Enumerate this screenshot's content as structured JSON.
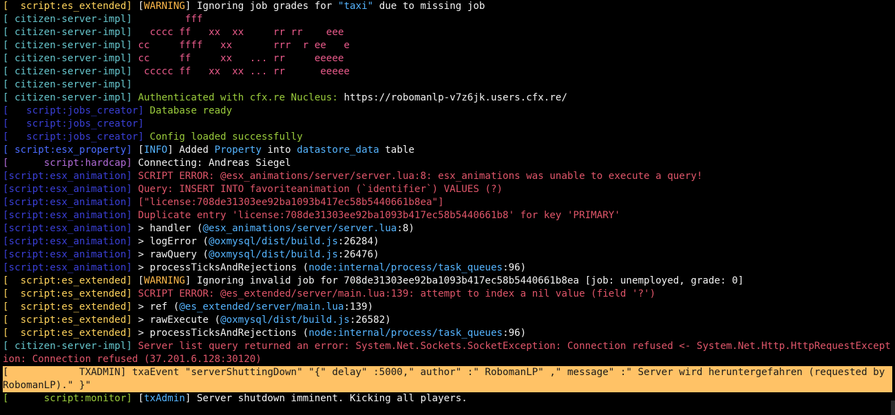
{
  "console": {
    "lines": [
      [
        [
          "c-yellow",
          "[  script:es_extended] "
        ],
        [
          "c-white",
          "["
        ],
        [
          "c-orange",
          "WARNING"
        ],
        [
          "c-white",
          "] Ignoring job grades for "
        ],
        [
          "c-lblue",
          "\"taxi\""
        ],
        [
          "c-white",
          " due to missing job"
        ]
      ],
      [
        [
          "c-cyan",
          "[ citizen-server-impl] "
        ],
        [
          "c-pink",
          "        fff"
        ]
      ],
      [
        [
          "c-cyan",
          "[ citizen-server-impl] "
        ],
        [
          "c-pink",
          "  cccc ff   xx  xx     rr rr    eee"
        ]
      ],
      [
        [
          "c-cyan",
          "[ citizen-server-impl] "
        ],
        [
          "c-pink",
          "cc     ffff   xx       rrr  r ee   e"
        ]
      ],
      [
        [
          "c-cyan",
          "[ citizen-server-impl] "
        ],
        [
          "c-pink",
          "cc     ff     xx   ... rr     eeeee"
        ]
      ],
      [
        [
          "c-cyan",
          "[ citizen-server-impl] "
        ],
        [
          "c-pink",
          " ccccc ff   xx  xx ... rr      eeeee"
        ]
      ],
      [
        [
          "c-cyan",
          "[ citizen-server-impl] "
        ]
      ],
      [
        [
          "c-cyan",
          "[ citizen-server-impl] "
        ],
        [
          "c-green",
          "Authenticated with cfx.re Nucleus: "
        ],
        [
          "c-white",
          "https://robomanlp-v7z6jk.users.cfx.re/"
        ]
      ],
      [
        [
          "c-navy",
          "[   script:jobs_creator] "
        ],
        [
          "c-green",
          "Database ready"
        ]
      ],
      [
        [
          "c-navy",
          "[   script:jobs_creator] "
        ]
      ],
      [
        [
          "c-navy",
          "[   script:jobs_creator] "
        ],
        [
          "c-green",
          "Config loaded successfully"
        ]
      ],
      [
        [
          "c-blue",
          "[ script:esx_property] "
        ],
        [
          "c-white",
          "["
        ],
        [
          "c-lblue",
          "INFO"
        ],
        [
          "c-white",
          "] Added "
        ],
        [
          "c-lblue",
          "Property"
        ],
        [
          "c-white",
          " into "
        ],
        [
          "c-lblue",
          "datastore_data"
        ],
        [
          "c-white",
          " table"
        ]
      ],
      [
        [
          "c-purple",
          "[      script:hardcap] "
        ],
        [
          "c-white",
          "Connecting: Andreas Siegel"
        ]
      ],
      [
        [
          "c-navy",
          "[script:esx_animation] "
        ],
        [
          "c-red",
          "SCRIPT ERROR: @esx_animations/server/server.lua:8: esx_animations was unable to execute a query!"
        ]
      ],
      [
        [
          "c-navy",
          "[script:esx_animation] "
        ],
        [
          "c-red",
          "Query: INSERT INTO favoriteanimation (`identifier`) VALUES (?)"
        ]
      ],
      [
        [
          "c-navy",
          "[script:esx_animation] "
        ],
        [
          "c-red",
          "[\"license:708de31303ee92ba1093b417ec58b5440661b8ea\"]"
        ]
      ],
      [
        [
          "c-navy",
          "[script:esx_animation] "
        ],
        [
          "c-red",
          "Duplicate entry 'license:708de31303ee92ba1093b417ec58b5440661b8' for key 'PRIMARY'"
        ]
      ],
      [
        [
          "c-navy",
          "[script:esx_animation] "
        ],
        [
          "c-white",
          "> handler ("
        ],
        [
          "c-lblue",
          "@esx_animations/server/server.lua"
        ],
        [
          "c-white",
          ":8)"
        ]
      ],
      [
        [
          "c-navy",
          "[script:esx_animation] "
        ],
        [
          "c-white",
          "> logError ("
        ],
        [
          "c-lblue",
          "@oxmysql/dist/build.js"
        ],
        [
          "c-white",
          ":26284)"
        ]
      ],
      [
        [
          "c-navy",
          "[script:esx_animation] "
        ],
        [
          "c-white",
          "> rawQuery ("
        ],
        [
          "c-lblue",
          "@oxmysql/dist/build.js"
        ],
        [
          "c-white",
          ":26476)"
        ]
      ],
      [
        [
          "c-navy",
          "[script:esx_animation] "
        ],
        [
          "c-white",
          "> processTicksAndRejections ("
        ],
        [
          "c-lblue",
          "node:internal/process/task_queues"
        ],
        [
          "c-white",
          ":96)"
        ]
      ],
      [
        [
          "c-yellow",
          "[  script:es_extended] "
        ],
        [
          "c-white",
          "["
        ],
        [
          "c-orange",
          "WARNING"
        ],
        [
          "c-white",
          "] Ignoring invalid job for 708de31303ee92ba1093b417ec58b5440661b8ea [job: unemployed, grade: 0]"
        ]
      ],
      [
        [
          "c-yellow",
          "[  script:es_extended] "
        ],
        [
          "c-red",
          "SCRIPT ERROR: @es_extended/server/main.lua:139: attempt to index a nil value (field '?')"
        ]
      ],
      [
        [
          "c-yellow",
          "[  script:es_extended] "
        ],
        [
          "c-white",
          "> ref ("
        ],
        [
          "c-lblue",
          "@es_extended/server/main.lua"
        ],
        [
          "c-white",
          ":139)"
        ]
      ],
      [
        [
          "c-yellow",
          "[  script:es_extended] "
        ],
        [
          "c-white",
          "> rawExecute ("
        ],
        [
          "c-lblue",
          "@oxmysql/dist/build.js"
        ],
        [
          "c-white",
          ":26582)"
        ]
      ],
      [
        [
          "c-yellow",
          "[  script:es_extended] "
        ],
        [
          "c-white",
          "> processTicksAndRejections ("
        ],
        [
          "c-lblue",
          "node:internal/process/task_queues"
        ],
        [
          "c-white",
          ":96)"
        ]
      ],
      [
        [
          "c-cyan",
          "[ citizen-server-impl] "
        ],
        [
          "c-red",
          "Server list query returned an error: System.Net.Sockets.SocketException: Connection refused <- System.Net.Http.HttpRequestException: Connection refused (37.201.6.128:30120)"
        ]
      ],
      [
        [
          "c-dark",
          "[            TXADMIN] "
        ],
        [
          "c-dark",
          "txaEvent \"serverShuttingDown\" \"{\" delay\" :5000,\" author\" :\" RobomanLP\" ,\" message\" :\" Server wird heruntergefahren (requested by RobomanLP).\" }\""
        ]
      ],
      [
        [
          "c-green",
          "[      script:monitor] "
        ],
        [
          "c-white",
          "["
        ],
        [
          "c-lblue",
          "txAdmin"
        ],
        [
          "c-white",
          "] Server shutdown imminent. Kicking all players."
        ]
      ]
    ],
    "highlight_line": 27
  }
}
